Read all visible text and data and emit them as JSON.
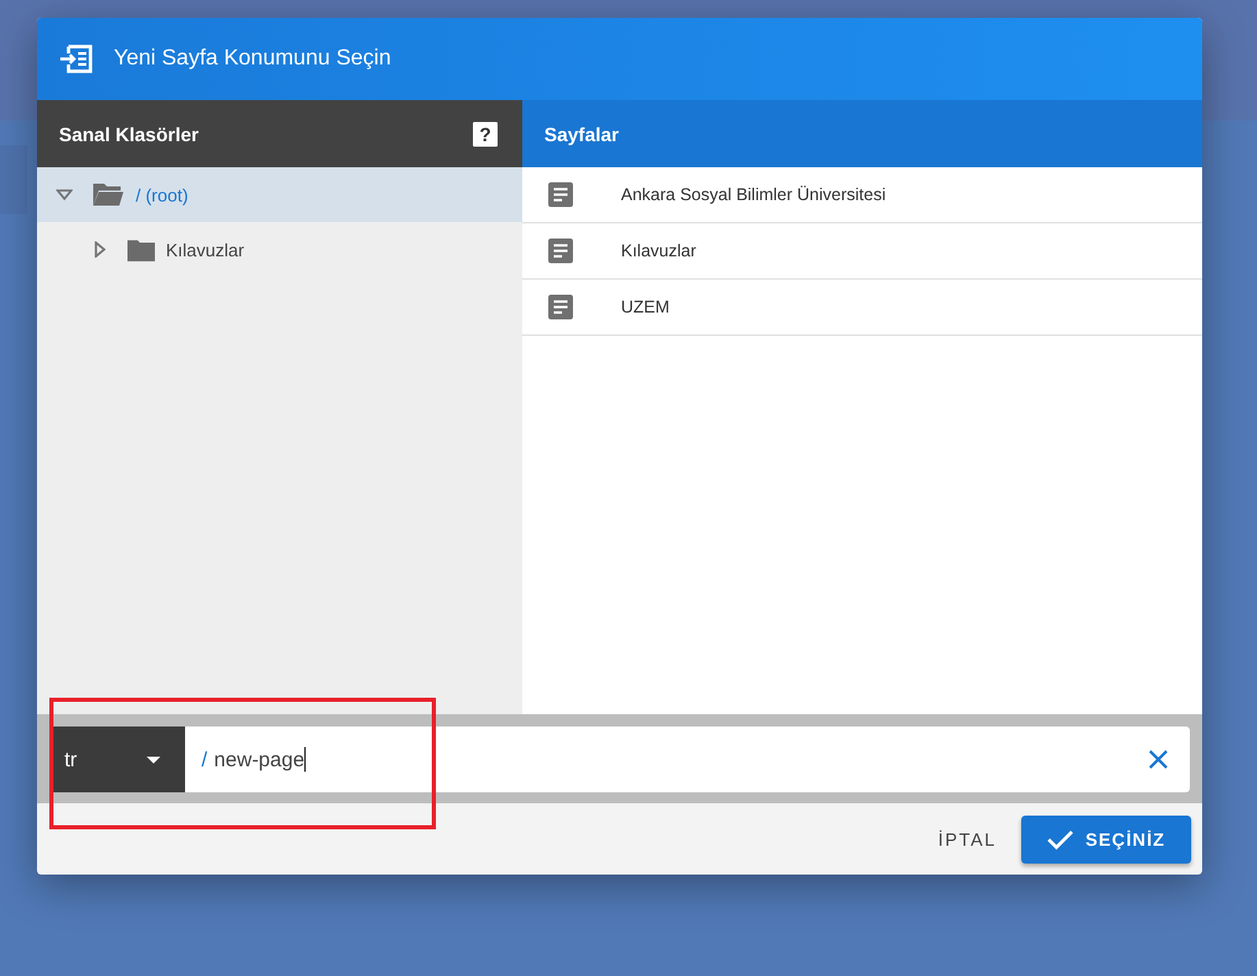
{
  "dialog": {
    "title": "Yeni Sayfa Konumunu Seçin",
    "folders": {
      "header": "Sanal Klasörler",
      "help": "?",
      "tree": [
        {
          "label": "/ (root)",
          "expanded": true,
          "selected": true,
          "children": [
            {
              "label": "Kılavuzlar",
              "expanded": false,
              "selected": false
            }
          ]
        }
      ]
    },
    "pages": {
      "header": "Sayfalar",
      "items": [
        {
          "label": "Ankara Sosyal Bilimler Üniversitesi"
        },
        {
          "label": "Kılavuzlar"
        },
        {
          "label": "UZEM"
        }
      ]
    },
    "path": {
      "locale": "tr",
      "prefix": "/",
      "value": "new-page"
    },
    "buttons": {
      "cancel": "İPTAL",
      "confirm": "SEÇİNİZ"
    }
  },
  "annotation": {
    "kind": "highlight-box"
  }
}
